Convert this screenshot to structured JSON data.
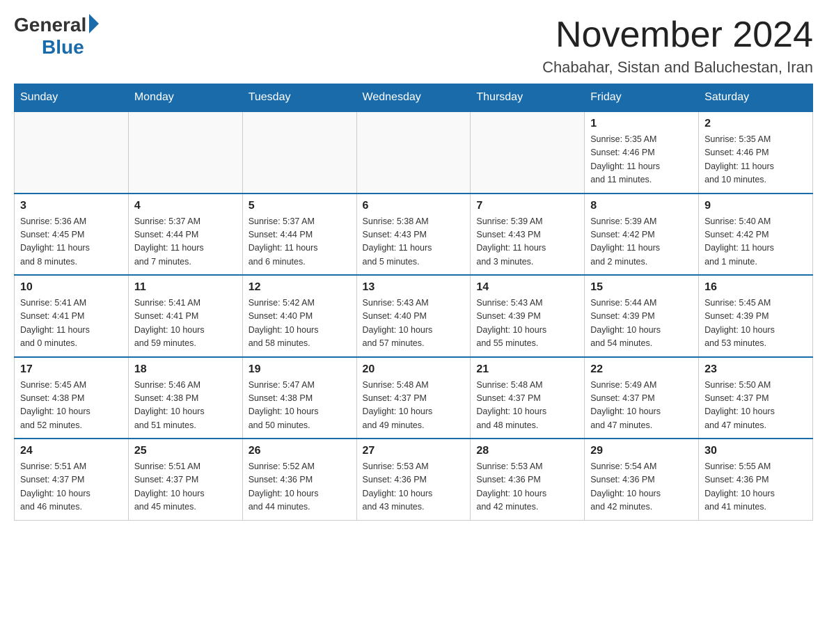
{
  "logo": {
    "general": "General",
    "blue": "Blue"
  },
  "title": "November 2024",
  "location": "Chabahar, Sistan and Baluchestan, Iran",
  "weekdays": [
    "Sunday",
    "Monday",
    "Tuesday",
    "Wednesday",
    "Thursday",
    "Friday",
    "Saturday"
  ],
  "weeks": [
    [
      {
        "day": "",
        "info": ""
      },
      {
        "day": "",
        "info": ""
      },
      {
        "day": "",
        "info": ""
      },
      {
        "day": "",
        "info": ""
      },
      {
        "day": "",
        "info": ""
      },
      {
        "day": "1",
        "info": "Sunrise: 5:35 AM\nSunset: 4:46 PM\nDaylight: 11 hours\nand 11 minutes."
      },
      {
        "day": "2",
        "info": "Sunrise: 5:35 AM\nSunset: 4:46 PM\nDaylight: 11 hours\nand 10 minutes."
      }
    ],
    [
      {
        "day": "3",
        "info": "Sunrise: 5:36 AM\nSunset: 4:45 PM\nDaylight: 11 hours\nand 8 minutes."
      },
      {
        "day": "4",
        "info": "Sunrise: 5:37 AM\nSunset: 4:44 PM\nDaylight: 11 hours\nand 7 minutes."
      },
      {
        "day": "5",
        "info": "Sunrise: 5:37 AM\nSunset: 4:44 PM\nDaylight: 11 hours\nand 6 minutes."
      },
      {
        "day": "6",
        "info": "Sunrise: 5:38 AM\nSunset: 4:43 PM\nDaylight: 11 hours\nand 5 minutes."
      },
      {
        "day": "7",
        "info": "Sunrise: 5:39 AM\nSunset: 4:43 PM\nDaylight: 11 hours\nand 3 minutes."
      },
      {
        "day": "8",
        "info": "Sunrise: 5:39 AM\nSunset: 4:42 PM\nDaylight: 11 hours\nand 2 minutes."
      },
      {
        "day": "9",
        "info": "Sunrise: 5:40 AM\nSunset: 4:42 PM\nDaylight: 11 hours\nand 1 minute."
      }
    ],
    [
      {
        "day": "10",
        "info": "Sunrise: 5:41 AM\nSunset: 4:41 PM\nDaylight: 11 hours\nand 0 minutes."
      },
      {
        "day": "11",
        "info": "Sunrise: 5:41 AM\nSunset: 4:41 PM\nDaylight: 10 hours\nand 59 minutes."
      },
      {
        "day": "12",
        "info": "Sunrise: 5:42 AM\nSunset: 4:40 PM\nDaylight: 10 hours\nand 58 minutes."
      },
      {
        "day": "13",
        "info": "Sunrise: 5:43 AM\nSunset: 4:40 PM\nDaylight: 10 hours\nand 57 minutes."
      },
      {
        "day": "14",
        "info": "Sunrise: 5:43 AM\nSunset: 4:39 PM\nDaylight: 10 hours\nand 55 minutes."
      },
      {
        "day": "15",
        "info": "Sunrise: 5:44 AM\nSunset: 4:39 PM\nDaylight: 10 hours\nand 54 minutes."
      },
      {
        "day": "16",
        "info": "Sunrise: 5:45 AM\nSunset: 4:39 PM\nDaylight: 10 hours\nand 53 minutes."
      }
    ],
    [
      {
        "day": "17",
        "info": "Sunrise: 5:45 AM\nSunset: 4:38 PM\nDaylight: 10 hours\nand 52 minutes."
      },
      {
        "day": "18",
        "info": "Sunrise: 5:46 AM\nSunset: 4:38 PM\nDaylight: 10 hours\nand 51 minutes."
      },
      {
        "day": "19",
        "info": "Sunrise: 5:47 AM\nSunset: 4:38 PM\nDaylight: 10 hours\nand 50 minutes."
      },
      {
        "day": "20",
        "info": "Sunrise: 5:48 AM\nSunset: 4:37 PM\nDaylight: 10 hours\nand 49 minutes."
      },
      {
        "day": "21",
        "info": "Sunrise: 5:48 AM\nSunset: 4:37 PM\nDaylight: 10 hours\nand 48 minutes."
      },
      {
        "day": "22",
        "info": "Sunrise: 5:49 AM\nSunset: 4:37 PM\nDaylight: 10 hours\nand 47 minutes."
      },
      {
        "day": "23",
        "info": "Sunrise: 5:50 AM\nSunset: 4:37 PM\nDaylight: 10 hours\nand 47 minutes."
      }
    ],
    [
      {
        "day": "24",
        "info": "Sunrise: 5:51 AM\nSunset: 4:37 PM\nDaylight: 10 hours\nand 46 minutes."
      },
      {
        "day": "25",
        "info": "Sunrise: 5:51 AM\nSunset: 4:37 PM\nDaylight: 10 hours\nand 45 minutes."
      },
      {
        "day": "26",
        "info": "Sunrise: 5:52 AM\nSunset: 4:36 PM\nDaylight: 10 hours\nand 44 minutes."
      },
      {
        "day": "27",
        "info": "Sunrise: 5:53 AM\nSunset: 4:36 PM\nDaylight: 10 hours\nand 43 minutes."
      },
      {
        "day": "28",
        "info": "Sunrise: 5:53 AM\nSunset: 4:36 PM\nDaylight: 10 hours\nand 42 minutes."
      },
      {
        "day": "29",
        "info": "Sunrise: 5:54 AM\nSunset: 4:36 PM\nDaylight: 10 hours\nand 42 minutes."
      },
      {
        "day": "30",
        "info": "Sunrise: 5:55 AM\nSunset: 4:36 PM\nDaylight: 10 hours\nand 41 minutes."
      }
    ]
  ]
}
